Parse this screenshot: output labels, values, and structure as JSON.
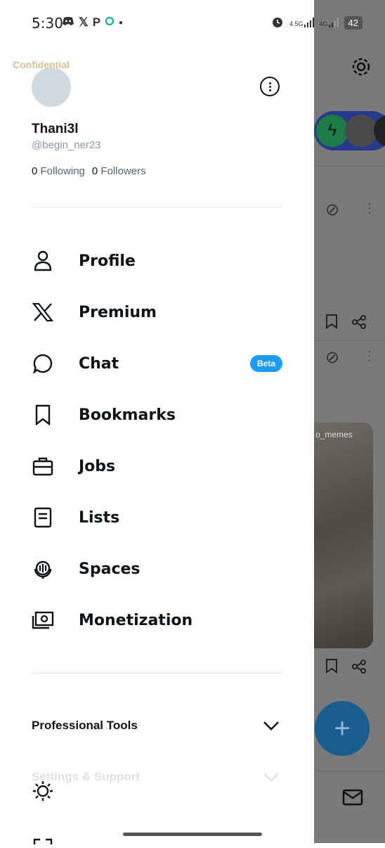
{
  "status_bar": {
    "time": "5:30",
    "net1": "4.5G",
    "net2": "4G",
    "battery": "42"
  },
  "watermark": "Confidential",
  "profile": {
    "display_name": "Thani3l",
    "handle": "@begin_ner23",
    "following_count": "0",
    "following_label": "Following",
    "followers_count": "0",
    "followers_label": "Followers"
  },
  "menu": {
    "items": [
      {
        "label": "Profile",
        "icon": "person-icon"
      },
      {
        "label": "Premium",
        "icon": "x-logo-icon"
      },
      {
        "label": "Chat",
        "icon": "chat-bubble-icon",
        "badge": "Beta"
      },
      {
        "label": "Bookmarks",
        "icon": "bookmark-icon"
      },
      {
        "label": "Jobs",
        "icon": "briefcase-icon"
      },
      {
        "label": "Lists",
        "icon": "list-icon"
      },
      {
        "label": "Spaces",
        "icon": "microphone-icon"
      },
      {
        "label": "Monetization",
        "icon": "money-icon"
      }
    ]
  },
  "sections": {
    "professional_tools": "Professional Tools",
    "settings_support": "Settings & Support"
  },
  "background": {
    "photo_label": "o_memes"
  },
  "colors": {
    "accent": "#1d9bf0",
    "text": "#0f1419",
    "muted": "#536471",
    "fab": "#1a5e8f"
  }
}
